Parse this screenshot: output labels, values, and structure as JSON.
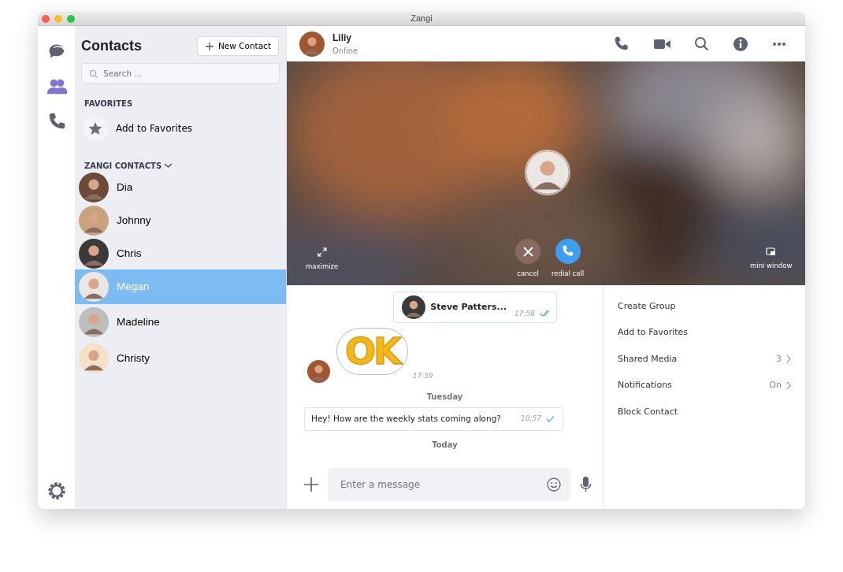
{
  "window": {
    "title": "Zangi"
  },
  "rail": [
    {
      "kind": "chats",
      "selected": false
    },
    {
      "kind": "contacts",
      "selected": true
    },
    {
      "kind": "calls",
      "selected": false
    },
    {
      "kind": "settings",
      "selected": false
    }
  ],
  "contacts_panel": {
    "title": "Contacts",
    "new_button": "New Contact",
    "search": {
      "placeholder": "Search ..."
    },
    "favorites_heading": "FAVORITES",
    "add_favorites": "Add to Favorites",
    "group_heading": "ZANGI CONTACTS",
    "contacts": [
      {
        "name": "Dia",
        "selected": false
      },
      {
        "name": "Johnny",
        "selected": false
      },
      {
        "name": "Chris",
        "selected": false
      },
      {
        "name": "Megan",
        "selected": true
      },
      {
        "name": "Madeline",
        "selected": false
      },
      {
        "name": "Christy",
        "selected": false
      }
    ]
  },
  "chat_header": {
    "name": "Liliy",
    "status": "Online"
  },
  "call": {
    "controls": [
      {
        "kind": "maximize",
        "label": "maximize"
      },
      {
        "kind": "cancel",
        "label": "cancel"
      },
      {
        "kind": "redial",
        "label": "redial call"
      },
      {
        "kind": "mini",
        "label": "mini window"
      }
    ]
  },
  "messages": [
    {
      "kind": "contact",
      "name": "Steve Patters...",
      "time": "17:58",
      "double_check": true
    },
    {
      "kind": "sticker",
      "text": "OK",
      "time": "17:59"
    },
    {
      "kind": "date",
      "text": "Tuesday"
    },
    {
      "kind": "text",
      "text": "Hey! How are the weekly stats coming along?",
      "time": "10:57",
      "double_check": false
    },
    {
      "kind": "date",
      "text": "Today"
    }
  ],
  "composer": {
    "placeholder": "Enter a message"
  },
  "info_menu": [
    {
      "label": "Create Group"
    },
    {
      "label": "Add to Favorites"
    },
    {
      "label": "Shared Media",
      "value": "3"
    },
    {
      "label": "Notifications",
      "value": "On"
    },
    {
      "label": "Block Contact"
    }
  ]
}
